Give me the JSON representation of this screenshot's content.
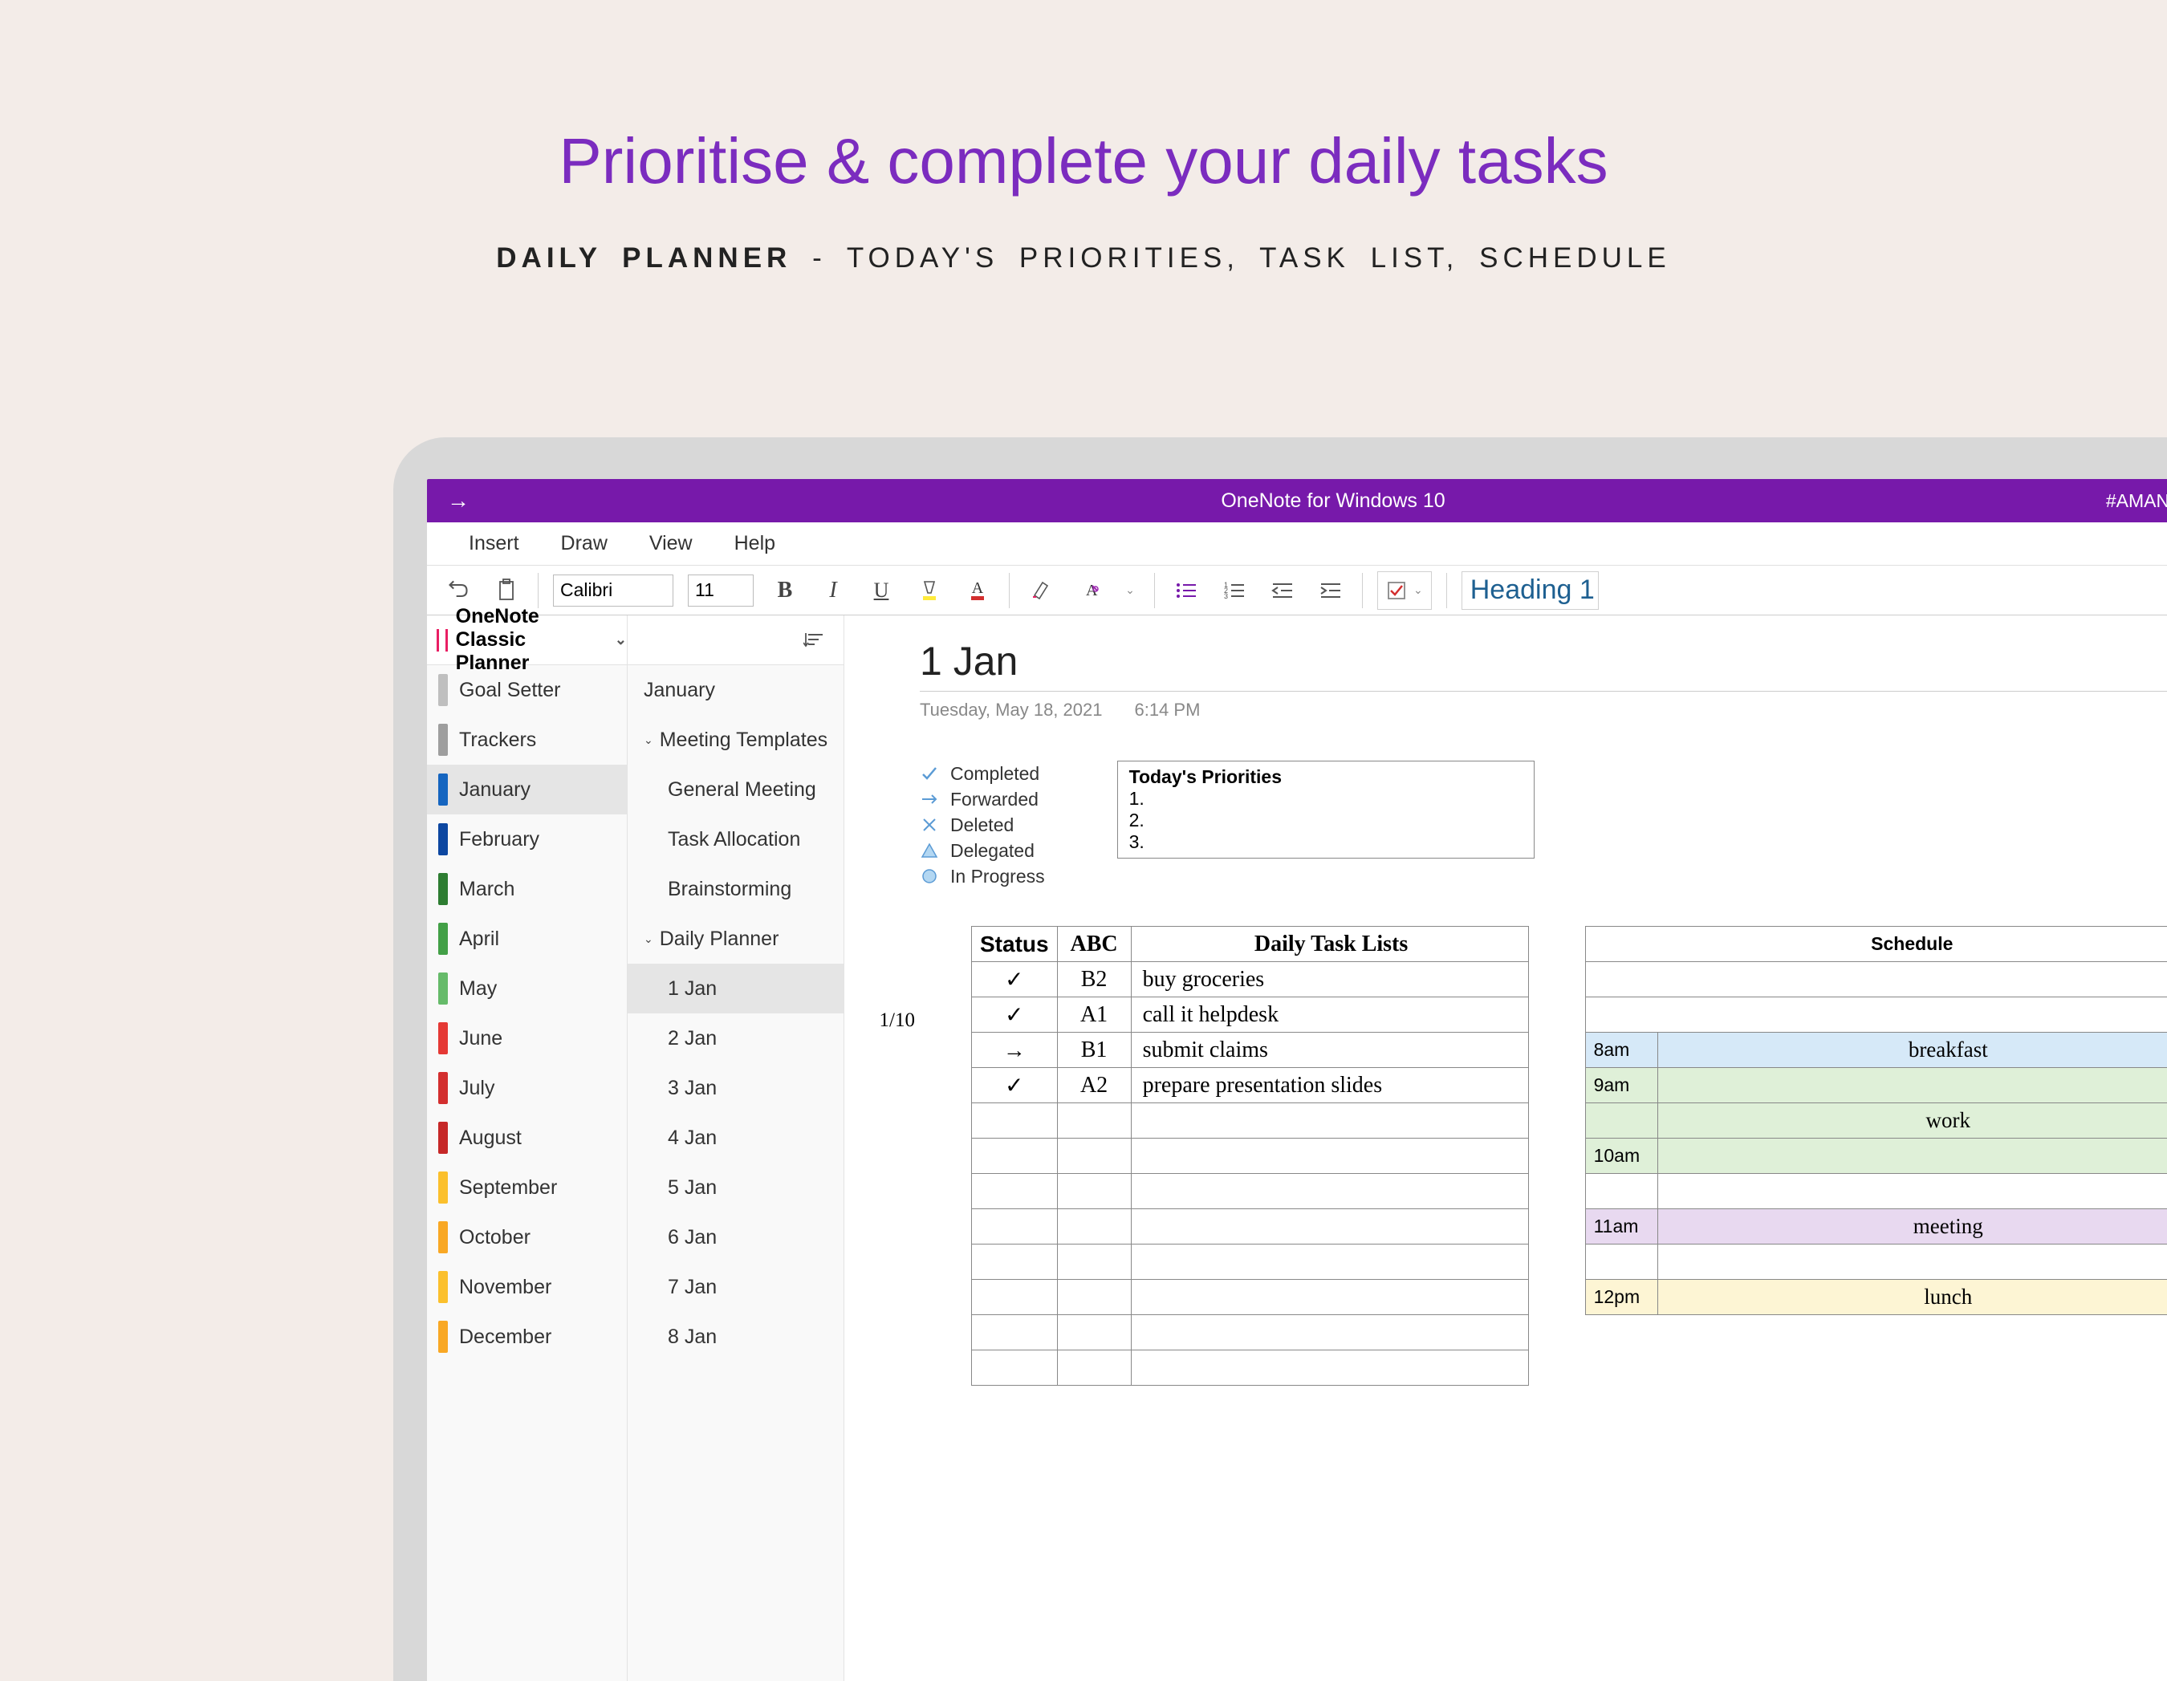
{
  "promo": {
    "title": "Prioritise & complete your daily tasks",
    "subtitle_bold": "DAILY PLANNER",
    "subtitle_rest": " - TODAY'S PRIORITIES, TASK LIST, SCHEDULE"
  },
  "titlebar": {
    "app_name": "OneNote for Windows 10",
    "notebook_tag": "#AMANDA SOH"
  },
  "menus": [
    "Insert",
    "Draw",
    "View",
    "Help"
  ],
  "ribbon": {
    "font_name": "Calibri",
    "font_size": "11",
    "heading_style": "Heading 1"
  },
  "notebook": {
    "name": "OneNote Classic Planner",
    "sections": [
      {
        "label": "Goal Setter",
        "color": "#bfbfbf"
      },
      {
        "label": "Trackers",
        "color": "#9e9e9e"
      },
      {
        "label": "January",
        "color": "#1565c0",
        "selected": true
      },
      {
        "label": "February",
        "color": "#0d47a1"
      },
      {
        "label": "March",
        "color": "#2e7d32"
      },
      {
        "label": "April",
        "color": "#43a047"
      },
      {
        "label": "May",
        "color": "#66bb6a"
      },
      {
        "label": "June",
        "color": "#e53935"
      },
      {
        "label": "July",
        "color": "#d32f2f"
      },
      {
        "label": "August",
        "color": "#c62828"
      },
      {
        "label": "September",
        "color": "#fbc02d"
      },
      {
        "label": "October",
        "color": "#f9a825"
      },
      {
        "label": "November",
        "color": "#fbc02d"
      },
      {
        "label": "December",
        "color": "#f9a825"
      }
    ]
  },
  "pages": [
    {
      "label": "January",
      "indent": 0
    },
    {
      "label": "Meeting Templates",
      "indent": 0,
      "expandable": true
    },
    {
      "label": "General Meeting",
      "indent": 1
    },
    {
      "label": "Task Allocation",
      "indent": 1
    },
    {
      "label": "Brainstorming",
      "indent": 1
    },
    {
      "label": "Daily Planner",
      "indent": 0,
      "expandable": true
    },
    {
      "label": "1 Jan",
      "indent": 1,
      "selected": true
    },
    {
      "label": "2 Jan",
      "indent": 1
    },
    {
      "label": "3 Jan",
      "indent": 1
    },
    {
      "label": "4 Jan",
      "indent": 1
    },
    {
      "label": "5 Jan",
      "indent": 1
    },
    {
      "label": "6 Jan",
      "indent": 1
    },
    {
      "label": "7 Jan",
      "indent": 1
    },
    {
      "label": "8 Jan",
      "indent": 1
    }
  ],
  "content": {
    "title": "1 Jan",
    "date": "Tuesday, May 18, 2021",
    "time": "6:14 PM",
    "legend": [
      {
        "icon": "check",
        "label": "Completed"
      },
      {
        "icon": "arrow",
        "label": "Forwarded"
      },
      {
        "icon": "cross",
        "label": "Deleted"
      },
      {
        "icon": "triangle",
        "label": "Delegated"
      },
      {
        "icon": "circle",
        "label": "In Progress"
      }
    ],
    "priorities_label": "Today's Priorities",
    "priorities": [
      "1.",
      "2.",
      "3."
    ],
    "task_headers": {
      "status": "Status",
      "abc": "ABC",
      "task": "Daily Task Lists"
    },
    "task_annotation": "1/10",
    "tasks": [
      {
        "status": "✓",
        "abc": "B2",
        "task": "buy groceries"
      },
      {
        "status": "✓",
        "abc": "A1",
        "task": "call it helpdesk"
      },
      {
        "status": "→",
        "abc": "B1",
        "task": "submit claims"
      },
      {
        "status": "✓",
        "abc": "A2",
        "task": "prepare presentation slides"
      }
    ],
    "schedule_header": "Schedule",
    "schedule": [
      {
        "time": "8am",
        "event": "breakfast",
        "bg": "bg-blue"
      },
      {
        "time": "9am",
        "event": "",
        "bg": "bg-green"
      },
      {
        "time": "",
        "event": "work",
        "bg": "bg-green"
      },
      {
        "time": "10am",
        "event": "",
        "bg": "bg-green"
      },
      {
        "time": "",
        "event": "",
        "bg": ""
      },
      {
        "time": "11am",
        "event": "meeting",
        "bg": "bg-purple"
      },
      {
        "time": "",
        "event": "",
        "bg": ""
      },
      {
        "time": "12pm",
        "event": "lunch",
        "bg": "bg-yellow"
      }
    ]
  }
}
